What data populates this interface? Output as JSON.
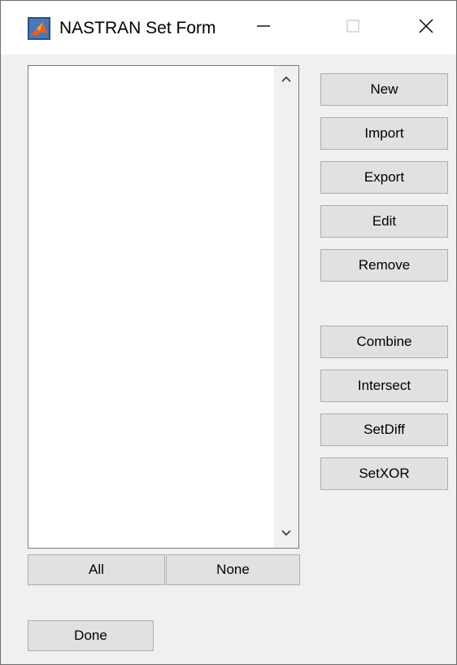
{
  "window": {
    "title": "NASTRAN Set Form"
  },
  "listbox": {
    "items": []
  },
  "buttons": {
    "new": "New",
    "import": "Import",
    "export": "Export",
    "edit": "Edit",
    "remove": "Remove",
    "combine": "Combine",
    "intersect": "Intersect",
    "setdiff": "SetDiff",
    "setxor": "SetXOR",
    "all": "All",
    "none": "None",
    "done": "Done"
  },
  "icons": {
    "app": "matlab-icon",
    "minimize": "minimize-icon",
    "maximize": "maximize-icon",
    "close": "close-icon",
    "scroll_up": "chevron-up-icon",
    "scroll_down": "chevron-down-icon"
  },
  "colors": {
    "window_bg": "#f0f0f0",
    "button_bg": "#e1e1e1",
    "button_border": "#adadad",
    "listbox_bg": "#ffffff"
  }
}
